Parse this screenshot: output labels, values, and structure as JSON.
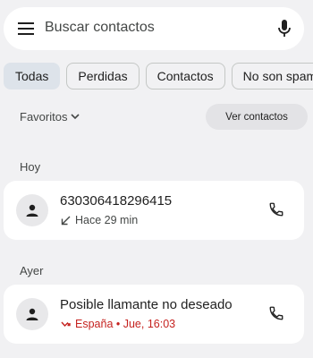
{
  "search": {
    "placeholder": "Buscar contactos"
  },
  "filters": [
    {
      "label": "Todas",
      "selected": true
    },
    {
      "label": "Perdidas",
      "selected": false
    },
    {
      "label": "Contactos",
      "selected": false
    },
    {
      "label": "No son spam",
      "selected": false
    }
  ],
  "favorites": {
    "label": "Favoritos",
    "see_all": "Ver contactos"
  },
  "sections": [
    {
      "title": "Hoy",
      "calls": [
        {
          "name": "630306418296415",
          "status_icon": "incoming-call-icon",
          "detail": "Hace 29 min",
          "missed": false
        }
      ]
    },
    {
      "title": "Ayer",
      "calls": [
        {
          "name": "Posible llamante no deseado",
          "status_icon": "missed-call-icon",
          "detail": "España • Jue, 16:03",
          "missed": true
        }
      ]
    }
  ],
  "colors": {
    "missed": "#c5221f",
    "selected_chip": "#dde3ea",
    "background": "#f1f1f3",
    "card": "#ffffff"
  }
}
